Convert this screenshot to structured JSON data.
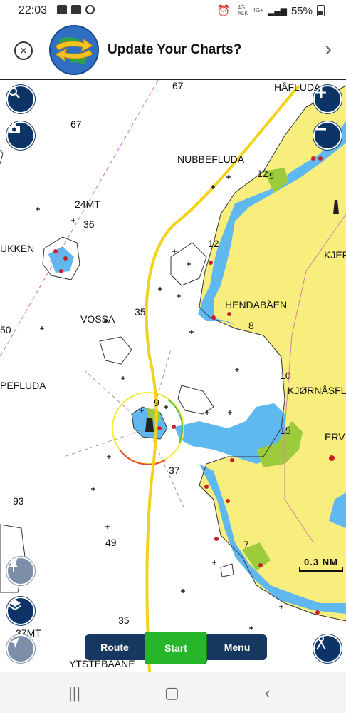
{
  "status": {
    "time": "22:03",
    "battery": "55%",
    "network": "4G",
    "network2": "4G+",
    "network_sub": "TALK"
  },
  "banner": {
    "title": "Update Your Charts?",
    "close_icon": "close-circle-icon",
    "next_icon": "chevron-right-icon"
  },
  "map_labels": [
    {
      "id": "depth-67a",
      "text": "67"
    },
    {
      "id": "hafluda",
      "text": "HÅFLUDA"
    },
    {
      "id": "depth-67b",
      "text": "67"
    },
    {
      "id": "nubbefluda",
      "text": "NUBBEFLUDA"
    },
    {
      "id": "depth-12a",
      "text": "12"
    },
    {
      "id": "depth-5",
      "text": "5"
    },
    {
      "id": "mt24",
      "text": "24MT"
    },
    {
      "id": "depth-36",
      "text": "36"
    },
    {
      "id": "ukken",
      "text": "UKKEN"
    },
    {
      "id": "depth-12b",
      "text": "12"
    },
    {
      "id": "kjer",
      "text": "KJER"
    },
    {
      "id": "hendabaen",
      "text": "HENDABÅEN"
    },
    {
      "id": "depth-35a",
      "text": "35"
    },
    {
      "id": "vossa",
      "text": "VOSSA"
    },
    {
      "id": "depth-8",
      "text": "8"
    },
    {
      "id": "depth-50",
      "text": "50"
    },
    {
      "id": "depth-10",
      "text": "10"
    },
    {
      "id": "kjornasfl",
      "text": "KJØRNÅSFL"
    },
    {
      "id": "pefluda",
      "text": "PEFLUDA"
    },
    {
      "id": "depth-9",
      "text": "9"
    },
    {
      "id": "depth-15",
      "text": "15"
    },
    {
      "id": "erv",
      "text": "ERV"
    },
    {
      "id": "depth-37",
      "text": "37"
    },
    {
      "id": "depth-93",
      "text": "93"
    },
    {
      "id": "depth-49",
      "text": "49"
    },
    {
      "id": "depth-7",
      "text": "7"
    },
    {
      "id": "depth-35b",
      "text": "35"
    },
    {
      "id": "mt37",
      "text": "37MT"
    },
    {
      "id": "ytstebaane",
      "text": "YTSTEBAANE"
    }
  ],
  "scale_label": "0.3 NM",
  "tabs": {
    "route": "Route",
    "start": "Start",
    "menu": "Menu"
  },
  "colors": {
    "land": "#f7ee7d",
    "shallow": "#5fb8ef",
    "drying": "#9ccc3d",
    "route_line": "#f3d21f",
    "button": "#0d3466",
    "start": "#27b52a"
  }
}
